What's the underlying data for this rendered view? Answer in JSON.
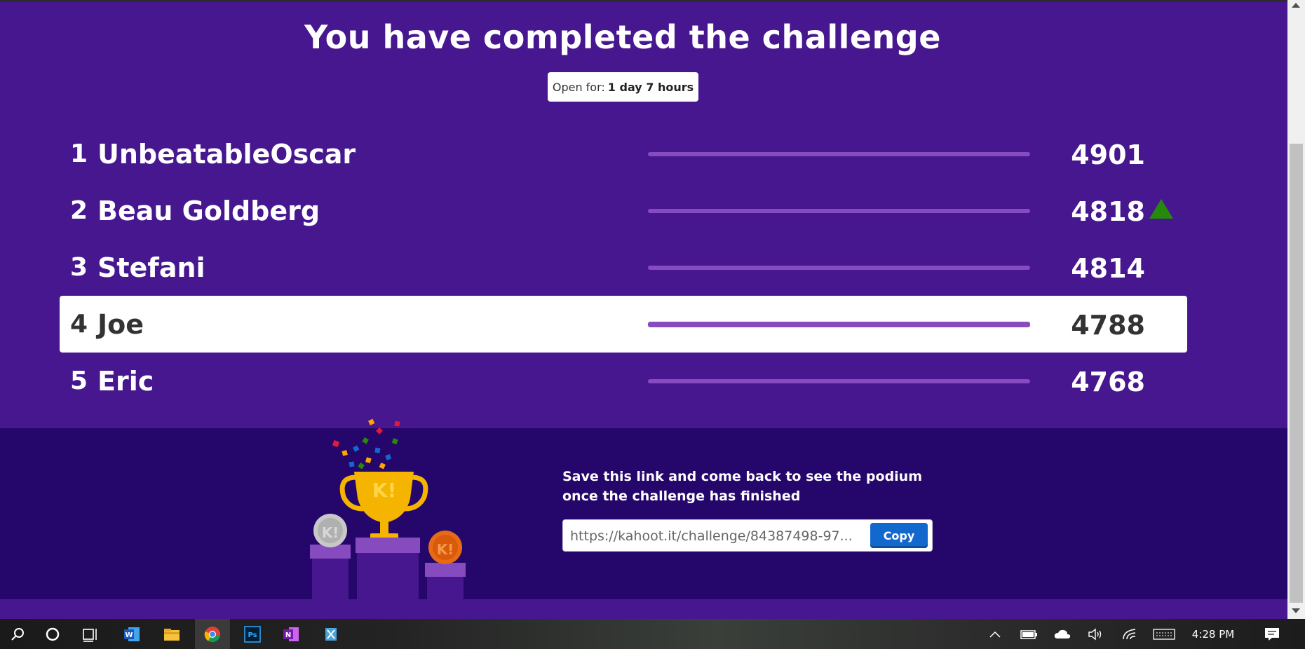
{
  "page": {
    "title": "You have completed the challenge",
    "open_for_label": "Open for:",
    "open_for_value": "1 day 7 hours"
  },
  "leaderboard": [
    {
      "rank": "1",
      "name": "UnbeatableOscar",
      "score": "4901",
      "trend": ""
    },
    {
      "rank": "2",
      "name": "Beau Goldberg",
      "score": "4818",
      "trend": "up"
    },
    {
      "rank": "3",
      "name": "Stefani",
      "score": "4814",
      "trend": ""
    },
    {
      "rank": "4",
      "name": "Joe",
      "score": "4788",
      "trend": "",
      "current_player": true
    },
    {
      "rank": "5",
      "name": "Eric",
      "score": "4768",
      "trend": ""
    }
  ],
  "share": {
    "message": "Save this link and come back to see the podium once the challenge has finished",
    "link": "https://kahoot.it/challenge/84387498-97...",
    "copy_label": "Copy"
  },
  "taskbar": {
    "apps": [
      "search-icon",
      "cortana-icon",
      "task-view-icon",
      "word-icon",
      "file-explorer-icon",
      "chrome-icon",
      "photoshop-icon",
      "onenote-icon",
      "snipping-tool-icon"
    ],
    "tray_icons": [
      "chevron-up-icon",
      "battery-icon",
      "onedrive-icon",
      "volume-icon",
      "wifi-icon",
      "keyboard-icon",
      "notification-icon"
    ],
    "clock": "4:28 PM"
  },
  "colors": {
    "background": "#46178f",
    "bottom_panel": "#25076b",
    "progress": "#864cbf",
    "copy_button": "#1368ce",
    "trend_up": "#26890c"
  }
}
